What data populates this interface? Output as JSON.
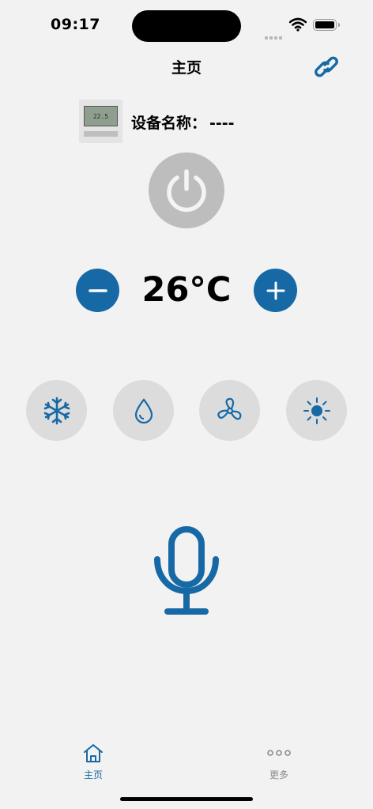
{
  "status_bar": {
    "time": "09:17"
  },
  "nav": {
    "title": "主页",
    "link_icon": "link-icon"
  },
  "device": {
    "label": "设备名称：",
    "name": "----",
    "thumb_reading": "22.5"
  },
  "controls": {
    "power_icon": "power-icon",
    "temperature": "26°C",
    "decrease_icon": "minus-icon",
    "increase_icon": "plus-icon"
  },
  "modes": [
    {
      "name": "cool",
      "icon": "snowflake-icon"
    },
    {
      "name": "dry",
      "icon": "water-drop-icon"
    },
    {
      "name": "fan",
      "icon": "fan-icon"
    },
    {
      "name": "heat",
      "icon": "sun-icon"
    }
  ],
  "voice": {
    "icon": "microphone-icon"
  },
  "tabbar": {
    "home_label": "主页",
    "more_label": "更多"
  },
  "colors": {
    "accent": "#1769a6",
    "power_inactive": "#bdbdbd",
    "mode_bg": "#dcdcdc",
    "background": "#f2f2f2"
  }
}
